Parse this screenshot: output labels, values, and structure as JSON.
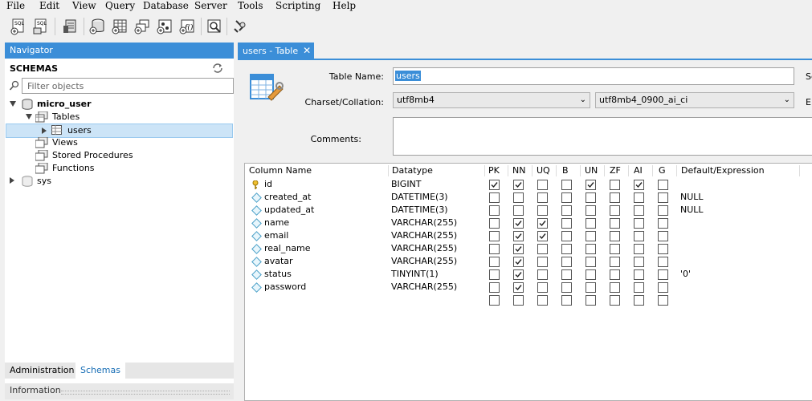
{
  "menu": [
    "File",
    "Edit",
    "View",
    "Query",
    "Database",
    "Server",
    "Tools",
    "Scripting",
    "Help"
  ],
  "navigator": {
    "title": "Navigator",
    "schemas_label": "SCHEMAS",
    "filter_placeholder": "Filter objects",
    "tree": {
      "schema1": "micro_user",
      "tables": "Tables",
      "users": "users",
      "views": "Views",
      "procs": "Stored Procedures",
      "functions": "Functions",
      "schema2": "sys"
    },
    "tabs": [
      "Administration",
      "Schemas"
    ],
    "info": "Information"
  },
  "editor": {
    "tab_label": "users - Table",
    "table_name_label": "Table Name:",
    "table_name": "users",
    "charset_label": "Charset/Collation:",
    "charset": "utf8mb4",
    "collation": "utf8mb4_0900_ai_ci",
    "comments_label": "Comments:",
    "right_cut_1": "Sc",
    "right_cut_2": "En"
  },
  "columns_header": [
    "Column Name",
    "Datatype",
    "PK",
    "NN",
    "UQ",
    "B",
    "UN",
    "ZF",
    "AI",
    "G",
    "Default/Expression"
  ],
  "rows": [
    {
      "name": "id",
      "type": "BIGINT",
      "flags": [
        1,
        1,
        0,
        0,
        1,
        0,
        1,
        0
      ],
      "default": "",
      "key": true
    },
    {
      "name": "created_at",
      "type": "DATETIME(3)",
      "flags": [
        0,
        0,
        0,
        0,
        0,
        0,
        0,
        0
      ],
      "default": "NULL",
      "key": false
    },
    {
      "name": "updated_at",
      "type": "DATETIME(3)",
      "flags": [
        0,
        0,
        0,
        0,
        0,
        0,
        0,
        0
      ],
      "default": "NULL",
      "key": false
    },
    {
      "name": "name",
      "type": "VARCHAR(255)",
      "flags": [
        0,
        1,
        1,
        0,
        0,
        0,
        0,
        0
      ],
      "default": "",
      "key": false
    },
    {
      "name": "email",
      "type": "VARCHAR(255)",
      "flags": [
        0,
        1,
        1,
        0,
        0,
        0,
        0,
        0
      ],
      "default": "",
      "key": false
    },
    {
      "name": "real_name",
      "type": "VARCHAR(255)",
      "flags": [
        0,
        1,
        0,
        0,
        0,
        0,
        0,
        0
      ],
      "default": "",
      "key": false
    },
    {
      "name": "avatar",
      "type": "VARCHAR(255)",
      "flags": [
        0,
        1,
        0,
        0,
        0,
        0,
        0,
        0
      ],
      "default": "",
      "key": false
    },
    {
      "name": "status",
      "type": "TINYINT(1)",
      "flags": [
        0,
        1,
        0,
        0,
        0,
        0,
        0,
        0
      ],
      "default": "'0'",
      "key": false
    },
    {
      "name": "password",
      "type": "VARCHAR(255)",
      "flags": [
        0,
        1,
        0,
        0,
        0,
        0,
        0,
        0
      ],
      "default": "",
      "key": false
    }
  ],
  "colors": {
    "accent": "#3b8ed8",
    "selection": "#cce4f7"
  }
}
